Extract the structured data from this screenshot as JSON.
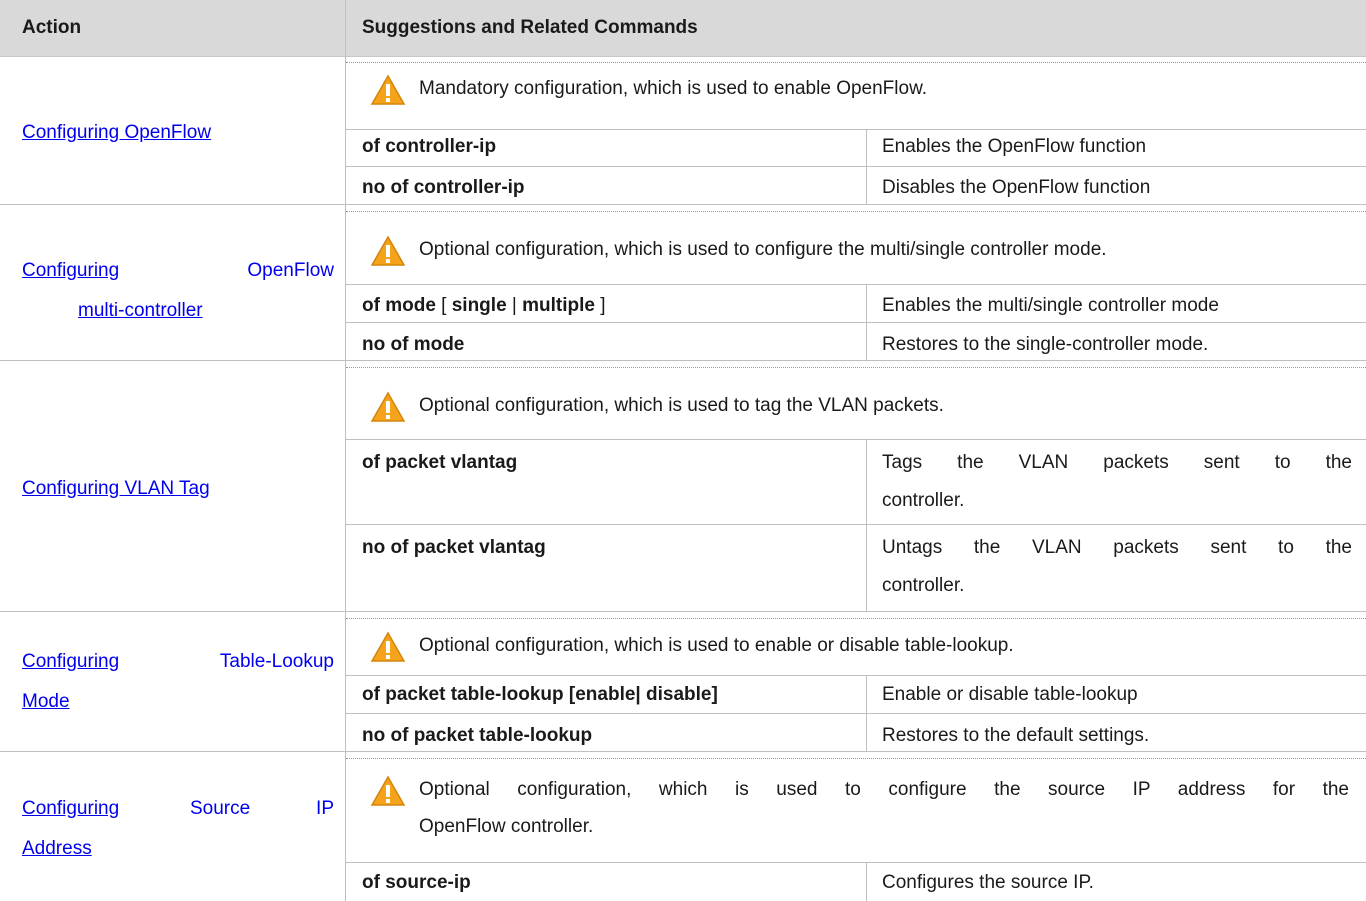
{
  "header": {
    "action": "Action",
    "suggestions": "Suggestions and Related Commands"
  },
  "rows": [
    {
      "action": "Configuring OpenFlow",
      "note": "Mandatory configuration, which is used to enable OpenFlow.",
      "commands": [
        {
          "cmd": "of controller-ip",
          "desc": "Enables the OpenFlow function"
        },
        {
          "cmd": "no of controller-ip",
          "desc": "Disables the OpenFlow function"
        }
      ]
    },
    {
      "action_line1_a": "Configuring",
      "action_line1_b": "OpenFlow",
      "action_line2": "multi-controller",
      "note": "Optional configuration, which is used to configure the multi/single controller mode.",
      "commands": [
        {
          "cmd_parts": [
            "of mode",
            " [ ",
            "single",
            " | ",
            "multiple",
            " ]"
          ],
          "desc": "Enables the multi/single controller mode"
        },
        {
          "cmd": "no of mode",
          "desc": "Restores to the single-controller mode."
        }
      ]
    },
    {
      "action": "Configuring VLAN Tag",
      "note": "Optional configuration, which is used to tag the VLAN packets.",
      "commands": [
        {
          "cmd": "of packet vlantag",
          "desc_line1": "Tags the VLAN packets sent to the",
          "desc_line2": "controller."
        },
        {
          "cmd": "no of packet vlantag",
          "desc_line1": "Untags the VLAN packets sent to the",
          "desc_line2": "controller."
        }
      ]
    },
    {
      "action_line1_a": "Configuring",
      "action_line1_b": "Table-Lookup",
      "action_line2": "Mode",
      "note": "Optional configuration, which is used to enable or disable table-lookup.",
      "commands": [
        {
          "cmd": "of packet table-lookup [enable| disable]",
          "desc": "Enable or disable table-lookup"
        },
        {
          "cmd": "no of packet table-lookup",
          "desc": "Restores to the default settings."
        }
      ]
    },
    {
      "action_line1_a": "Configuring",
      "action_line1_b": "Source",
      "action_line1_c": "IP",
      "action_line2": "Address",
      "note_line1": "Optional configuration, which is used to configure the source IP address for the",
      "note_line2": "OpenFlow controller.",
      "commands": [
        {
          "cmd": "of source-ip",
          "desc": "Configures the source IP."
        }
      ]
    }
  ]
}
